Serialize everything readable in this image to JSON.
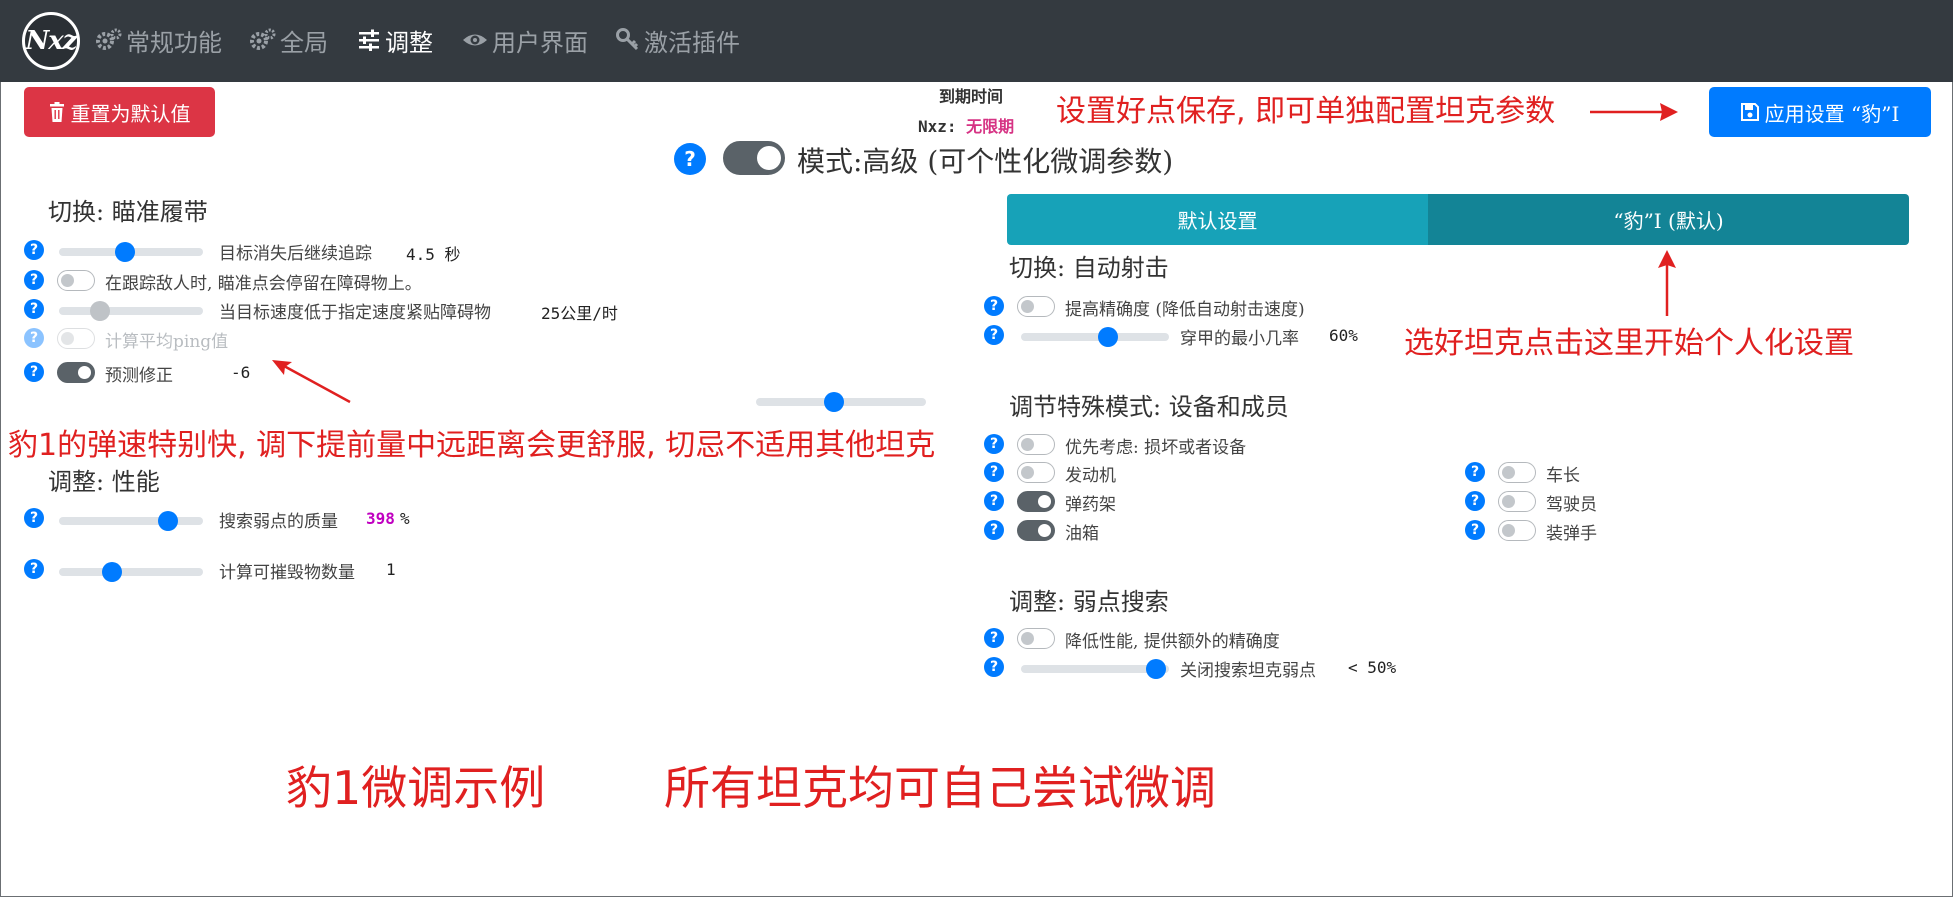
{
  "navbar": {
    "logo": "Nxz",
    "items": [
      {
        "label": "常规功能",
        "icon": "gears-icon"
      },
      {
        "label": "全局",
        "icon": "gears-icon"
      },
      {
        "label": "调整",
        "icon": "sliders-icon"
      },
      {
        "label": "用户界面",
        "icon": "eye-icon"
      },
      {
        "label": "激活插件",
        "icon": "key-icon"
      }
    ],
    "active_index": 2
  },
  "toolbar": {
    "reset_label": "重置为默认值",
    "apply_label": "应用设置 “豹”I",
    "reset_color": "#dc3545",
    "apply_color": "#007bff"
  },
  "expiry": {
    "label": "到期时间",
    "prefix": "Nxz:",
    "value": "无限期",
    "value_color": "#d63384"
  },
  "mode": {
    "label": "模式:高级 (可个性化微调参数)",
    "enabled": true
  },
  "left": {
    "section1": {
      "title": "切换: 瞄准履带",
      "rows": [
        {
          "label": "目标消失后继续追踪",
          "value": "4.5 秒",
          "type": "slider",
          "level": 0.45
        },
        {
          "label": "在跟踪敌人时, 瞄准点会停留在障碍物上。",
          "type": "switch",
          "on": false
        },
        {
          "label": "当目标速度低于指定速度紧贴障碍物",
          "value": "25公里/时",
          "type": "slider",
          "level": 0.25,
          "muted": true
        },
        {
          "label": "计算平均ping值",
          "type": "switch",
          "on": false,
          "disabled": true
        },
        {
          "label": "预测修正",
          "value": "-6",
          "type": "switch",
          "on": true
        }
      ]
    },
    "section2": {
      "title": "调整: 性能",
      "rows": [
        {
          "label": "搜索弱点的质量",
          "value": "398",
          "unit": "%",
          "value_color": "#c000c0",
          "type": "slider",
          "level": 0.8
        },
        {
          "label": "计算可摧毁物数量",
          "value": "1",
          "type": "slider",
          "level": 0.35
        }
      ]
    },
    "center_slider_level": 0.45
  },
  "tabs": [
    {
      "label": "默认设置",
      "color": "#17a2b8"
    },
    {
      "label": "“豹”I (默认)",
      "color": "#138496"
    }
  ],
  "right": {
    "section1": {
      "title": "切换: 自动射击",
      "rows": [
        {
          "label": "提高精确度 (降低自动射击速度)",
          "type": "switch",
          "on": false
        },
        {
          "label": "穿甲的最小几率",
          "value": "60%",
          "type": "slider",
          "level": 0.6
        }
      ]
    },
    "section2": {
      "title": "调节特殊模式: 设备和成员",
      "priority": "优先考虑: 损坏或者设备",
      "col1": [
        {
          "label": "发动机",
          "on": false
        },
        {
          "label": "弹药架",
          "on": true
        },
        {
          "label": "油箱",
          "on": true
        }
      ],
      "col2": [
        {
          "label": "车长",
          "on": false
        },
        {
          "label": "驾驶员",
          "on": false
        },
        {
          "label": "装弹手",
          "on": false
        }
      ]
    },
    "section3": {
      "title": "调整: 弱点搜索",
      "rows": [
        {
          "label": "降低性能, 提供额外的精确度",
          "type": "switch",
          "on": false
        },
        {
          "label": "关闭搜索坦克弱点",
          "value": "< 50%",
          "type": "slider",
          "level": 0.98
        }
      ]
    }
  },
  "annotations": {
    "save_note": "设置好点保存, 即可单独配置坦克参数",
    "tank_note": "选好坦克点击这里开始个人化设置",
    "leopard_note": "豹1的弹速特别快, 调下提前量中远距离会更舒服, 切忌不适用其他坦克",
    "example_title": "豹1微调示例",
    "all_tanks_note": "所有坦克均可自己尝试微调",
    "color": "#e02020"
  }
}
